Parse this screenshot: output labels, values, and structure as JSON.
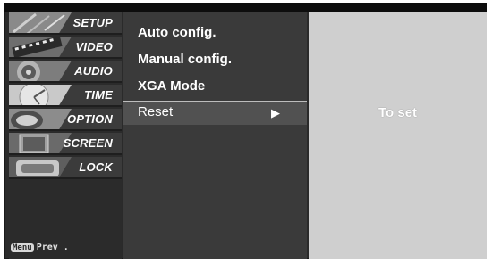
{
  "sidebar": {
    "items": [
      {
        "label": "SETUP"
      },
      {
        "label": "VIDEO"
      },
      {
        "label": "AUDIO"
      },
      {
        "label": "TIME"
      },
      {
        "label": "OPTION"
      },
      {
        "label": "SCREEN"
      },
      {
        "label": "LOCK"
      }
    ],
    "prev": {
      "key": "Menu",
      "label": "Prev ."
    }
  },
  "submenu": {
    "items": [
      {
        "label": "Auto config."
      },
      {
        "label": "Manual config."
      },
      {
        "label": "XGA Mode"
      },
      {
        "label": "Reset",
        "selected": true,
        "arrow": "▶"
      }
    ]
  },
  "panel": {
    "action": "To set"
  },
  "colors": {
    "frame": "#2a2a2a",
    "sidebar": "#2b2b2b",
    "submenu": "#3a3a3a",
    "selected_row": "#515151",
    "panel": "#cfcfcf"
  }
}
